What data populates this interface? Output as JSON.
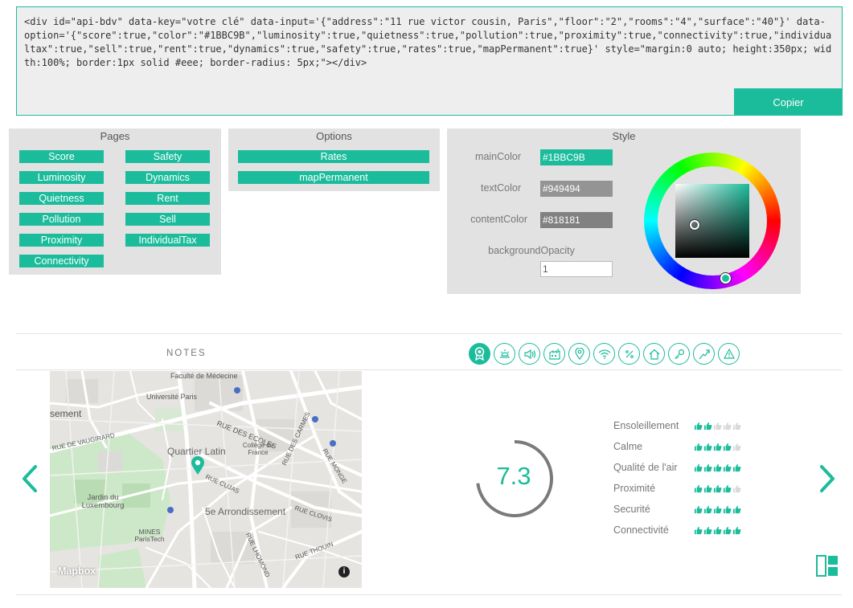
{
  "code": {
    "text": "<div id=\"api-bdv\" data-key=\"votre clé\" data-input='{\"address\":\"11 rue victor cousin, Paris\",\"floor\":\"2\",\"rooms\":\"4\",\"surface\":\"40\"}' data-\noption='{\"score\":true,\"color\":\"#1BBC9B\",\"luminosity\":true,\"quietness\":true,\"pollution\":true,\"proximity\":true,\"connectivity\":true,\"individualtax\":true,\"sell\":true,\"rent\":true,\"dynamics\":true,\"safety\":true,\"rates\":true,\"mapPermanent\":true}' style=\"margin:0 auto; height:350px; width:100%; border:1px solid #eee; border-radius: 5px;\"></div>",
    "copy_label": "Copier"
  },
  "pages": {
    "title": "Pages",
    "items": [
      "Score",
      "Luminosity",
      "Quietness",
      "Pollution",
      "Proximity",
      "Connectivity",
      "Safety",
      "Dynamics",
      "Rent",
      "Sell",
      "IndividualTax"
    ]
  },
  "options": {
    "title": "Options",
    "items": [
      "Rates",
      "mapPermanent"
    ]
  },
  "style": {
    "title": "Style",
    "main_color_label": "mainColor",
    "main_color_value": "#1BBC9B",
    "text_color_label": "textColor",
    "text_color_value": "#949494",
    "content_color_label": "contentColor",
    "content_color_value": "#818181",
    "bg_opacity_label": "backgroundOpacity",
    "bg_opacity_value": "1"
  },
  "notes": {
    "title": "NOTES",
    "icons": [
      "score-icon",
      "luminosity-icon",
      "quietness-icon",
      "pollution-icon",
      "proximity-icon",
      "connectivity-icon",
      "tax-icon",
      "sell-icon",
      "rent-icon",
      "dynamics-icon",
      "safety-icon"
    ],
    "score": "7.3",
    "score_fraction": 0.73,
    "criteria": [
      {
        "label": "Ensoleillement",
        "rating": 2
      },
      {
        "label": "Calme",
        "rating": 4
      },
      {
        "label": "Qualité de l'air",
        "rating": 5
      },
      {
        "label": "Proximité",
        "rating": 4
      },
      {
        "label": "Securité",
        "rating": 5
      },
      {
        "label": "Connectivité",
        "rating": 5
      }
    ]
  },
  "map": {
    "labels": {
      "faculte": "Faculté de Médecine",
      "universite": "Université Paris",
      "sement": "sement",
      "rue_ecoles": "RUE DES ECOLES",
      "rue_carmes": "RUE DES CARMES",
      "rue_vaugirard": "RUE DE VAUGIRARD",
      "quartier": "Quartier Latin",
      "college": "Collège de France",
      "rue_monge": "RUE MONGE",
      "rue_cujas": "RUE CUJAS",
      "jardin": "Jardin du Luxembourg",
      "arr": "5e Arrondissement",
      "rue_clovis": "RUE CLOVIS",
      "mines": "MINES ParisTech",
      "rue_lhomond": "RUE LHOMOND",
      "rue_thouin": "RUE THOUIN",
      "mapbox": "Mapbox",
      "info": "i"
    }
  },
  "colors": {
    "accent": "#1BBC9B",
    "panel_bg": "#e2e2e2",
    "text": "#949494",
    "content": "#818181"
  }
}
